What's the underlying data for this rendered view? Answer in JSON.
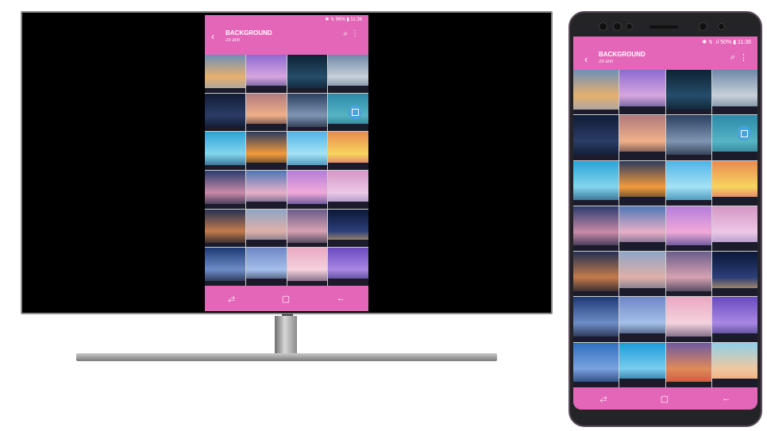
{
  "status_bar": {
    "tv_text": "✱ ↯ 96% ▮ 11:36",
    "phone_text": "✱ ↯ .ıl 50% ▮ 11:36"
  },
  "app_bar": {
    "title": "BACKGROUND",
    "tv_subtitle": "29 ảnh",
    "phone_subtitle": "29 ảnh",
    "back_icon": "‹",
    "search_icon": "⌕",
    "more_icon": "⋮"
  },
  "nav_bar": {
    "recents_icon": "⥄",
    "home_icon": "▢",
    "back_icon": "←"
  },
  "photos": [
    {
      "top": "#6d8fb8",
      "mid": "#e7b06e",
      "bot": "#9aa3b0"
    },
    {
      "top": "#8d6ad0",
      "mid": "#d7a6df",
      "bot": "#3b3e7a"
    },
    {
      "top": "#0d2234",
      "mid": "#254d6b",
      "bot": "#0b1b29"
    },
    {
      "top": "#6e88a8",
      "mid": "#c9d1da",
      "bot": "#58708a"
    },
    {
      "top": "#101b36",
      "mid": "#2b3d66",
      "bot": "#0a1326"
    },
    {
      "top": "#b07a7d",
      "mid": "#f0b088",
      "bot": "#2a2030"
    },
    {
      "top": "#2c405f",
      "mid": "#7f96b3",
      "bot": "#1a2437"
    },
    {
      "top": "#2a8aa8",
      "mid": "#56b4c4",
      "bot": "#1f6b80"
    },
    {
      "top": "#2aa3d6",
      "mid": "#84d6ee",
      "bot": "#1d4f78"
    },
    {
      "top": "#2e3b5e",
      "mid": "#f29b3c",
      "bot": "#1b1e28"
    },
    {
      "top": "#4fb5e6",
      "mid": "#a5e2f5",
      "bot": "#2d7ea8"
    },
    {
      "top": "#e98a50",
      "mid": "#f7d55d",
      "bot": "#d44c7a"
    },
    {
      "top": "#2b3d6e",
      "mid": "#c98aa8",
      "bot": "#16203c"
    },
    {
      "top": "#4e77b6",
      "mid": "#e8b0c8",
      "bot": "#38466b"
    },
    {
      "top": "#b57ddb",
      "mid": "#f0a9d8",
      "bot": "#3e3f8a"
    },
    {
      "top": "#d596c7",
      "mid": "#ecc8e6",
      "bot": "#8c7cb6"
    },
    {
      "top": "#253154",
      "mid": "#c37a4b",
      "bot": "#10172a"
    },
    {
      "top": "#8ea5c6",
      "mid": "#e0b0a8",
      "bot": "#4d6180"
    },
    {
      "top": "#6b5d8a",
      "mid": "#d6a2b1",
      "bot": "#2e3048"
    },
    {
      "top": "#0b1838",
      "mid": "#2b3e78",
      "bot": "#f0b865"
    },
    {
      "top": "#1e3a74",
      "mid": "#6d8dc6",
      "bot": "#151a30"
    },
    {
      "top": "#6f86c6",
      "mid": "#a4c0ea",
      "bot": "#1a2440"
    },
    {
      "top": "#e9a8c2",
      "mid": "#f5d2dd",
      "bot": "#5b4a6a"
    },
    {
      "top": "#6a4bc0",
      "mid": "#a887e4",
      "bot": "#2c2a6c"
    },
    {
      "top": "#2f6ec0",
      "mid": "#7aa3e0",
      "bot": "#143060"
    },
    {
      "top": "#1c9bd8",
      "mid": "#79cdef",
      "bot": "#0e4f7a"
    },
    {
      "top": "#6d5aa0",
      "mid": "#e08a5a",
      "bot": "#c94a3a"
    },
    {
      "top": "#8fd0ea",
      "mid": "#f0c8a0",
      "bot": "#f0a070"
    }
  ]
}
